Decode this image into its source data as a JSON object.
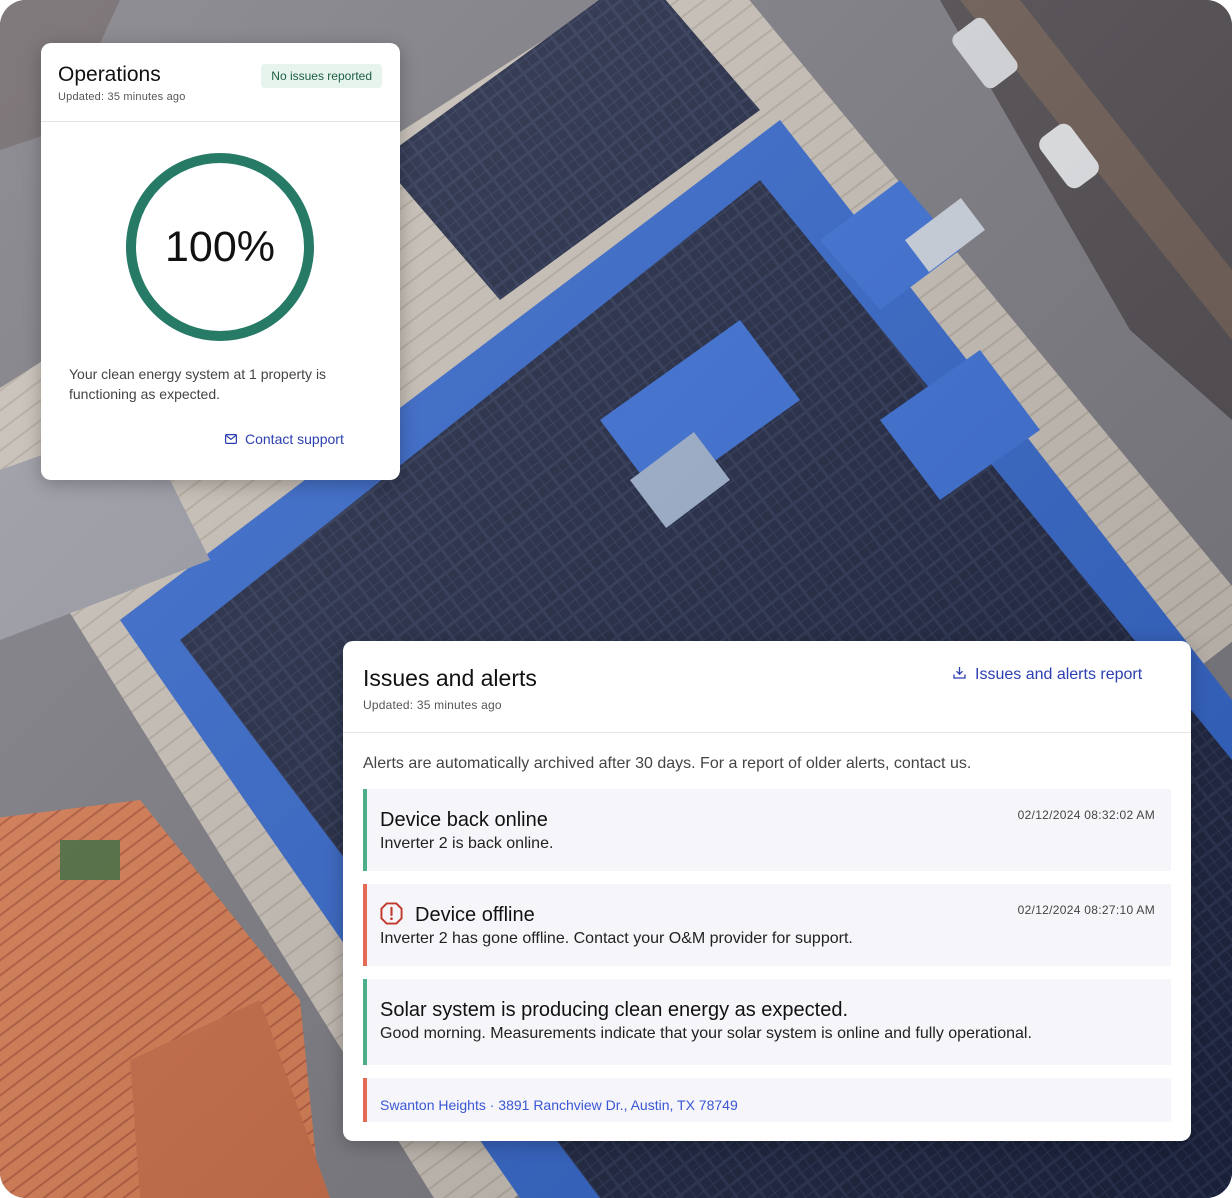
{
  "operations": {
    "title": "Operations",
    "updated": "Updated: 35 minutes ago",
    "badge": "No issues reported",
    "percent": "100%",
    "percent_value": 1.0,
    "ring_color": "#267a66",
    "description": "Your clean energy system at 1 property is functioning as expected.",
    "contact_label": "Contact support",
    "contact_icon": "mail-icon"
  },
  "alerts": {
    "title": "Issues and alerts",
    "updated": "Updated: 35 minutes ago",
    "report_label": "Issues and alerts report",
    "report_icon": "download-icon",
    "note": "Alerts are automatically archived after 30 days. For a report of older alerts, contact us.",
    "items": [
      {
        "title": "Device back online",
        "description": "Inverter 2 is back online.",
        "timestamp": "02/12/2024 08:32:02 AM",
        "severity": "ok",
        "accent": "#4caf8a"
      },
      {
        "title": "Device offline",
        "description": "Inverter 2 has gone offline. Contact your O&M provider for support.",
        "timestamp": "02/12/2024 08:27:10 AM",
        "severity": "warning",
        "icon": "alert-octagon-icon",
        "accent": "#e56a55"
      },
      {
        "title": "Solar system is producing clean energy as expected.",
        "description": "Good morning. Measurements indicate that your solar system is online and fully operational.",
        "severity": "ok",
        "accent": "#4caf8a"
      },
      {
        "location": "Swanton Heights · 3891 Ranchview Dr., Austin, TX 78749",
        "severity": "warning",
        "accent": "#e56a55"
      }
    ]
  }
}
